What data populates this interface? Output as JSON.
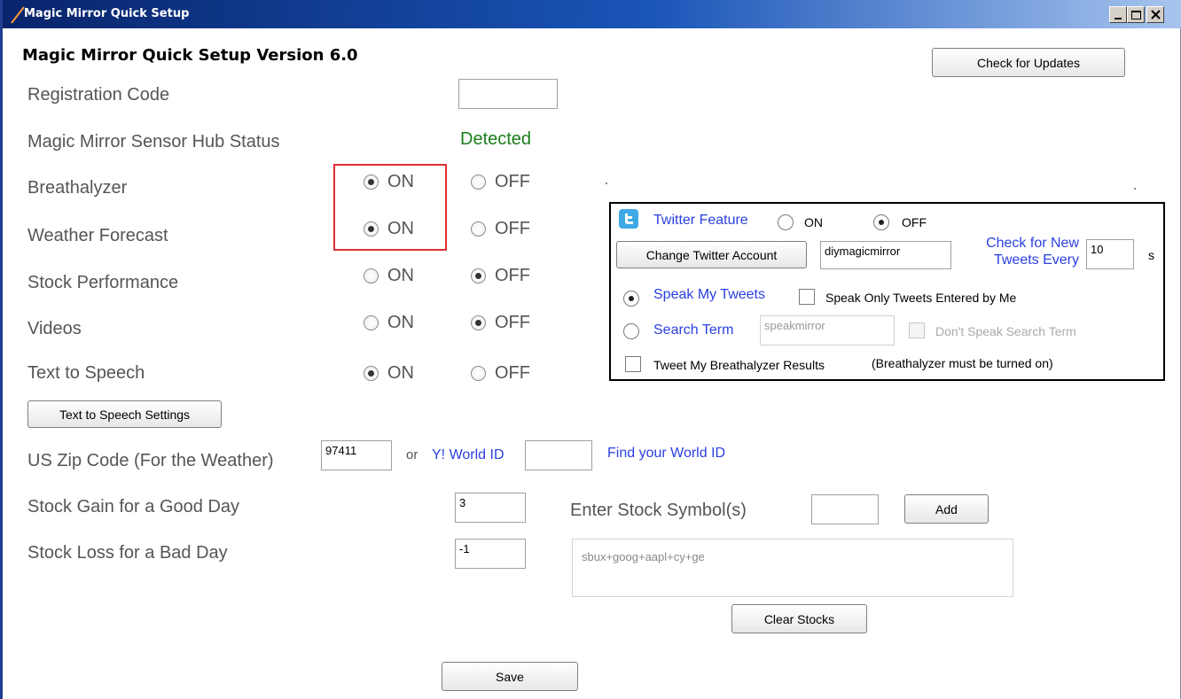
{
  "window": {
    "title": "Magic Mirror Quick Setup",
    "colors": {
      "titlebar": "#08246b",
      "accent_blue": "#2a3fe0",
      "status_green": "#1a7f1a",
      "highlight_red": "#e03030"
    }
  },
  "header": {
    "app_title": "Magic Mirror Quick Setup Version 6.0",
    "check_updates_label": "Check for Updates"
  },
  "registration": {
    "label": "Registration Code",
    "value": ""
  },
  "sensor_hub": {
    "label": "Magic Mirror Sensor Hub Status",
    "status": "Detected"
  },
  "features": [
    {
      "label": "Breathalyzer",
      "on_label": "ON",
      "off_label": "OFF",
      "selected": "ON"
    },
    {
      "label": "Weather Forecast",
      "on_label": "ON",
      "off_label": "OFF",
      "selected": "ON"
    },
    {
      "label": "Stock Performance",
      "on_label": "ON",
      "off_label": "OFF",
      "selected": "OFF"
    },
    {
      "label": "Videos",
      "on_label": "ON",
      "off_label": "OFF",
      "selected": "OFF"
    },
    {
      "label": "Text to Speech",
      "on_label": "ON",
      "off_label": "OFF",
      "selected": "ON"
    }
  ],
  "tts_settings_label": "Text to Speech Settings",
  "weather": {
    "zip_label": "US Zip Code (For the Weather)",
    "zip_value": "97411",
    "or_label": "or",
    "world_id_label": "Y! World ID",
    "world_id_value": "",
    "find_world_id_link": "Find your World ID"
  },
  "stocks": {
    "gain_label": "Stock Gain for a Good Day",
    "gain_value": "3",
    "loss_label": "Stock Loss for a Bad Day",
    "loss_value": "-1",
    "symbol_label": "Enter Stock Symbol(s)",
    "symbol_value": "",
    "add_label": "Add",
    "list_value": "sbux+goog+aapl+cy+ge",
    "clear_label": "Clear Stocks"
  },
  "twitter": {
    "icon": "twitter-icon",
    "feature_label": "Twitter Feature",
    "on_label": "ON",
    "off_label": "OFF",
    "selected": "OFF",
    "change_account_label": "Change Twitter Account",
    "account_value": "diymagicmirror",
    "check_new_label_line1": "Check for New",
    "check_new_label_line2": "Tweets Every",
    "interval_value": "10",
    "interval_unit": "s",
    "speak_my_tweets_label": "Speak My Tweets",
    "speak_my_tweets_selected": true,
    "speak_only_mine_label": "Speak Only Tweets Entered by Me",
    "speak_only_mine_checked": false,
    "search_term_label": "Search Term",
    "search_term_selected": false,
    "search_term_value": "speakmirror",
    "dont_speak_label": "Don't Speak Search Term",
    "tweet_breath_label": "Tweet My Breathalyzer Results",
    "tweet_breath_note": "(Breathalyzer must be turned on)",
    "tweet_breath_checked": false
  },
  "save_label": "Save"
}
